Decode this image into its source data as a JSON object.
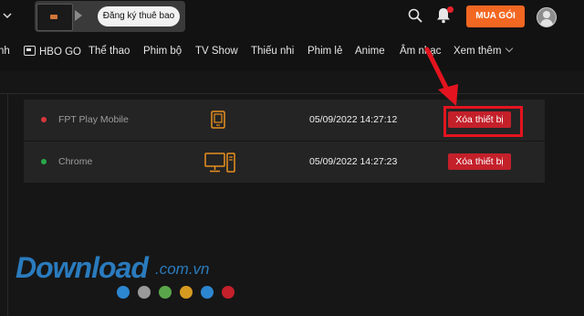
{
  "header": {
    "subscribe_label": "Đăng ký thuê bao",
    "buy_label": "MUA GÓI"
  },
  "nav": {
    "items": [
      "nh",
      "HBO GO",
      "Thể thao",
      "Phim bộ",
      "TV Show",
      "Thiếu nhi",
      "Phim lẻ",
      "Anime",
      "Âm nhạc",
      "Xem thêm"
    ]
  },
  "devices": [
    {
      "name": "FPT Play Mobile",
      "status": "offline",
      "status_color": "#d9363e",
      "icon": "tablet-icon",
      "time": "05/09/2022 14:27:12",
      "remove_label": "Xóa thiết bị"
    },
    {
      "name": "Chrome",
      "status": "online",
      "status_color": "#2aa84a",
      "icon": "desktop-computer-icon",
      "time": "05/09/2022 14:27:23",
      "remove_label": "Xóa thiết bị"
    }
  ],
  "colors": {
    "accent": "#f26722",
    "icon_orange": "#e8901f",
    "danger": "#c3202a",
    "annotation_red": "#e3141f"
  },
  "watermark": {
    "brand": "Download",
    "domain": ".com.vn",
    "dot_colors": [
      "#2d86d0",
      "#9a9a9a",
      "#5aa64a",
      "#d69a20",
      "#2d86d0",
      "#c3202a"
    ]
  }
}
